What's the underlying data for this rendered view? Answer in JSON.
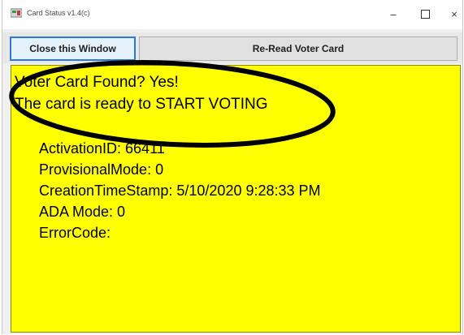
{
  "window": {
    "title": "Card Status v1.4(c)",
    "icon": "app-icon",
    "controls": {
      "minimize": "–",
      "close": "×"
    }
  },
  "toolbar": {
    "close_label": "Close this Window",
    "reread_label": "Re-Read Voter Card"
  },
  "status": {
    "found_line": "Voter Card Found?  Yes!",
    "ready_line": "The card is ready to START VOTING"
  },
  "fields": {
    "activation": "ActivationID: 66411",
    "provisional": "ProvisionalMode: 0",
    "creation": "CreationTimeStamp: 5/10/2020 9:28:33 PM",
    "ada": "ADA Mode: 0",
    "error": "ErrorCode:"
  },
  "colors": {
    "panel_background": "#ffff00",
    "annotation_ink": "#000000",
    "focus_border": "#2f7ad8"
  }
}
